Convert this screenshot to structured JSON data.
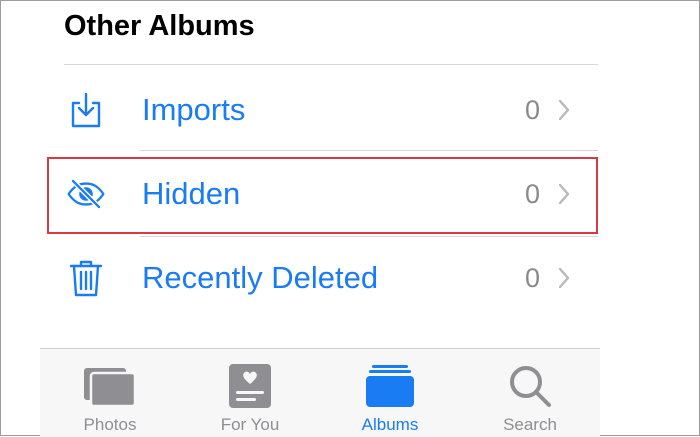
{
  "section": {
    "title": "Other Albums"
  },
  "albums": [
    {
      "label": "Imports",
      "count": "0",
      "icon": "import-icon"
    },
    {
      "label": "Hidden",
      "count": "0",
      "icon": "eye-slash-icon"
    },
    {
      "label": "Recently Deleted",
      "count": "0",
      "icon": "trash-icon"
    }
  ],
  "highlighted_row": "Hidden",
  "tabs": [
    {
      "label": "Photos",
      "icon": "photos-icon",
      "active": false
    },
    {
      "label": "For You",
      "icon": "for-you-icon",
      "active": false
    },
    {
      "label": "Albums",
      "icon": "albums-icon",
      "active": true
    },
    {
      "label": "Search",
      "icon": "search-icon",
      "active": false
    }
  ],
  "colors": {
    "accent": "#1a7cf2",
    "highlight_border": "#d63a44",
    "inactive_tab": "#8e8e93"
  }
}
